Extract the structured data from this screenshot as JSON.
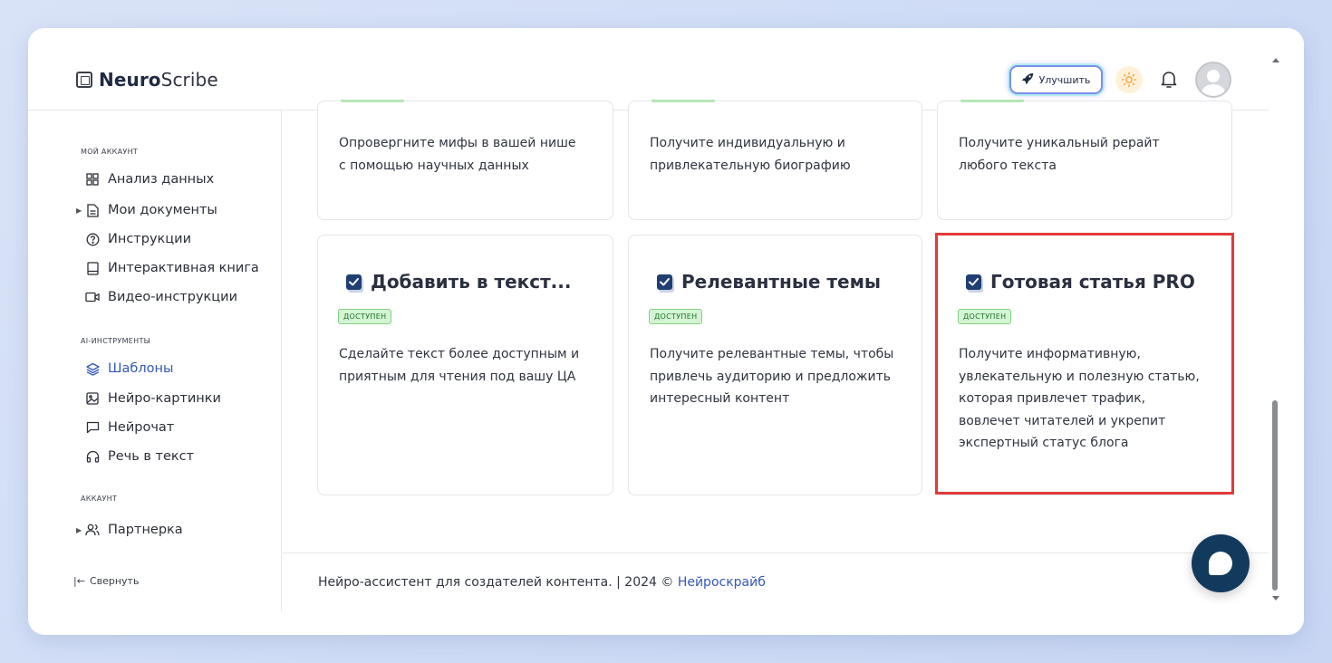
{
  "app": {
    "logo_bold": "Neuro",
    "logo_rest": "Scribe"
  },
  "header": {
    "upgrade_label": "Улучшить"
  },
  "sidebar": {
    "section_account": "МОЙ АККАУНТ",
    "items_account": [
      {
        "label": "Анализ данных",
        "icon": "grid-icon"
      },
      {
        "label": "Мои документы",
        "icon": "document-icon"
      },
      {
        "label": "Инструкции",
        "icon": "help-circle-icon"
      },
      {
        "label": "Интерактивная книга",
        "icon": "book-icon"
      },
      {
        "label": "Видео-инструкции",
        "icon": "video-icon"
      }
    ],
    "section_ai": "AI-ИНСТРУМЕНТЫ",
    "items_ai": [
      {
        "label": "Шаблоны",
        "icon": "layers-icon"
      },
      {
        "label": "Нейро-картинки",
        "icon": "image-icon"
      },
      {
        "label": "Нейрочат",
        "icon": "chat-icon"
      },
      {
        "label": "Речь в текст",
        "icon": "headphones-icon"
      }
    ],
    "section_other": "АККАУНТ",
    "items_other": [
      {
        "label": "Партнерка",
        "icon": "users-icon"
      }
    ],
    "collapse_label": "Свернуть"
  },
  "cards_top": [
    {
      "desc": [
        "Опровергните мифы в вашей нише",
        "с помощью научных данных"
      ]
    },
    {
      "desc": [
        "Получите индивидуальную и",
        "привлекательную биографию"
      ]
    },
    {
      "desc": [
        "Получите уникальный рерайт",
        "любого текста"
      ]
    }
  ],
  "cards": [
    {
      "title": "Добавить в текст...",
      "badge": "ДОСТУПЕН",
      "desc": [
        "Сделайте текст более доступным и",
        "приятным для чтения под вашу ЦА"
      ]
    },
    {
      "title": "Релевантные темы",
      "badge": "ДОСТУПЕН",
      "desc": [
        "Получите релевантные темы, чтобы",
        "привлечь аудиторию и предложить",
        "интересный контент"
      ]
    },
    {
      "title": "Готовая статья PRO",
      "badge": "ДОСТУПЕН",
      "desc": [
        "Получите информативную,",
        "увлекательную и полезную статью,",
        "которая привлечет трафик,",
        "вовлечет читателей и укрепит",
        "экспертный статус блога"
      ]
    }
  ],
  "footer": {
    "text": "Нейро-ассистент для создателей контента.  | 2024 © ",
    "link": "Нейроскрайб"
  },
  "colors": {
    "accent": "#3558b8",
    "badge_bg": "#d4f5d4",
    "highlight": "#e33a3a",
    "fab": "#123a5c"
  }
}
